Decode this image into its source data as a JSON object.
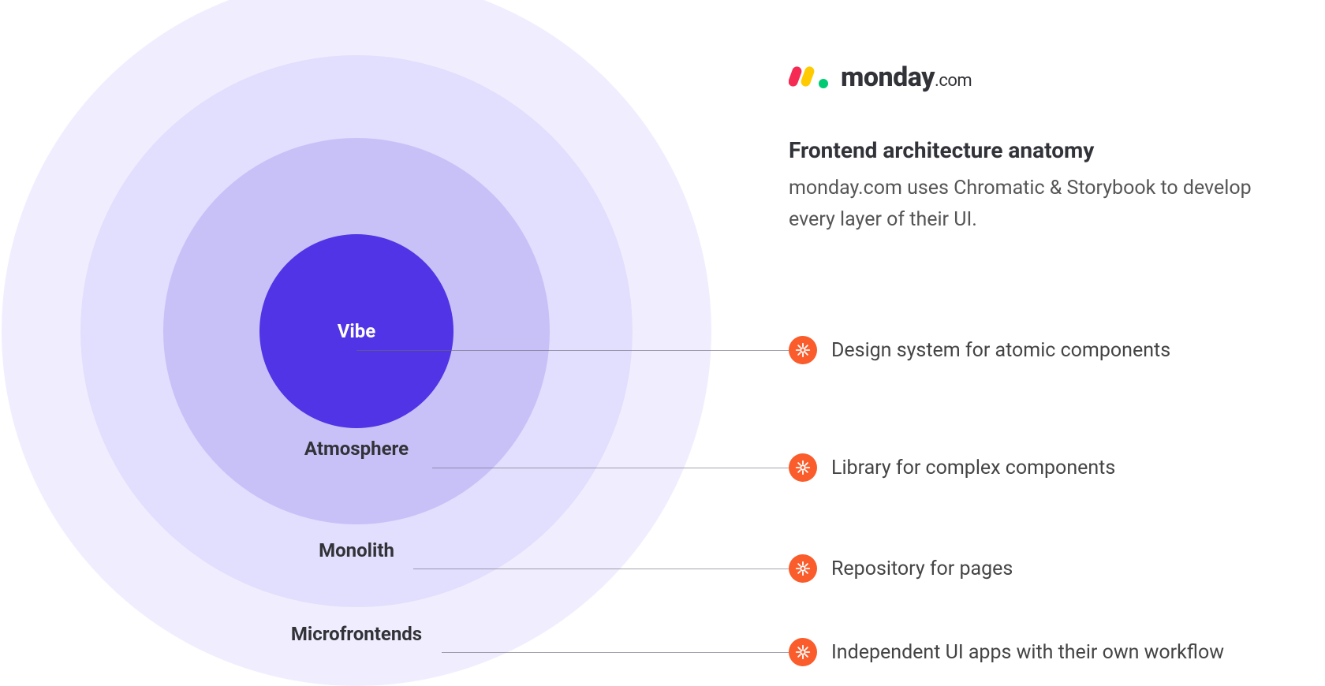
{
  "brand": {
    "name": "monday",
    "suffix": ".com"
  },
  "headline": {
    "title": "Frontend architecture anatomy",
    "description": "monday.com uses Chromatic & Storybook to develop every layer of their UI."
  },
  "layers": [
    {
      "name": "Vibe",
      "description": "Design system for atomic components"
    },
    {
      "name": "Atmosphere",
      "description": "Library for complex components"
    },
    {
      "name": "Monolith",
      "description": "Repository for pages"
    },
    {
      "name": "Microfrontends",
      "description": "Independent UI apps with their own workflow"
    }
  ],
  "colors": {
    "core": "#5034e5",
    "ring2": "#c7c1f8",
    "ring3": "#e2defd",
    "ring4": "#f0eefe",
    "badge": "#FA5C2B"
  }
}
